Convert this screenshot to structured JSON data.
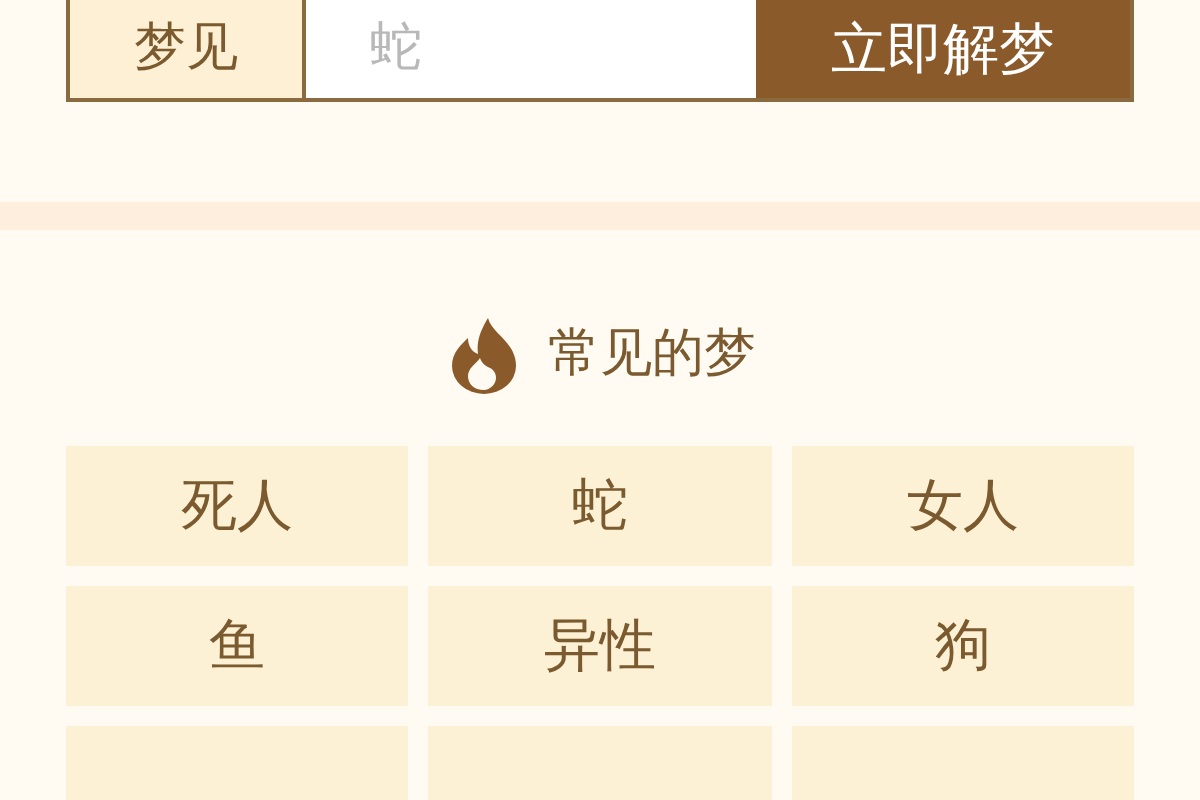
{
  "search": {
    "label": "梦见",
    "placeholder": "蛇",
    "button": "立即解梦"
  },
  "section": {
    "title": "常见的梦"
  },
  "dreams": [
    {
      "kind": "tag",
      "label": "死人"
    },
    {
      "kind": "tag",
      "label": "蛇"
    },
    {
      "kind": "tag",
      "label": "女人"
    },
    {
      "kind": "tag",
      "label": "鱼"
    },
    {
      "kind": "tag",
      "label": "异性"
    },
    {
      "kind": "tag",
      "label": "狗"
    },
    {
      "kind": "cut"
    },
    {
      "kind": "cut"
    },
    {
      "kind": "cut"
    }
  ]
}
